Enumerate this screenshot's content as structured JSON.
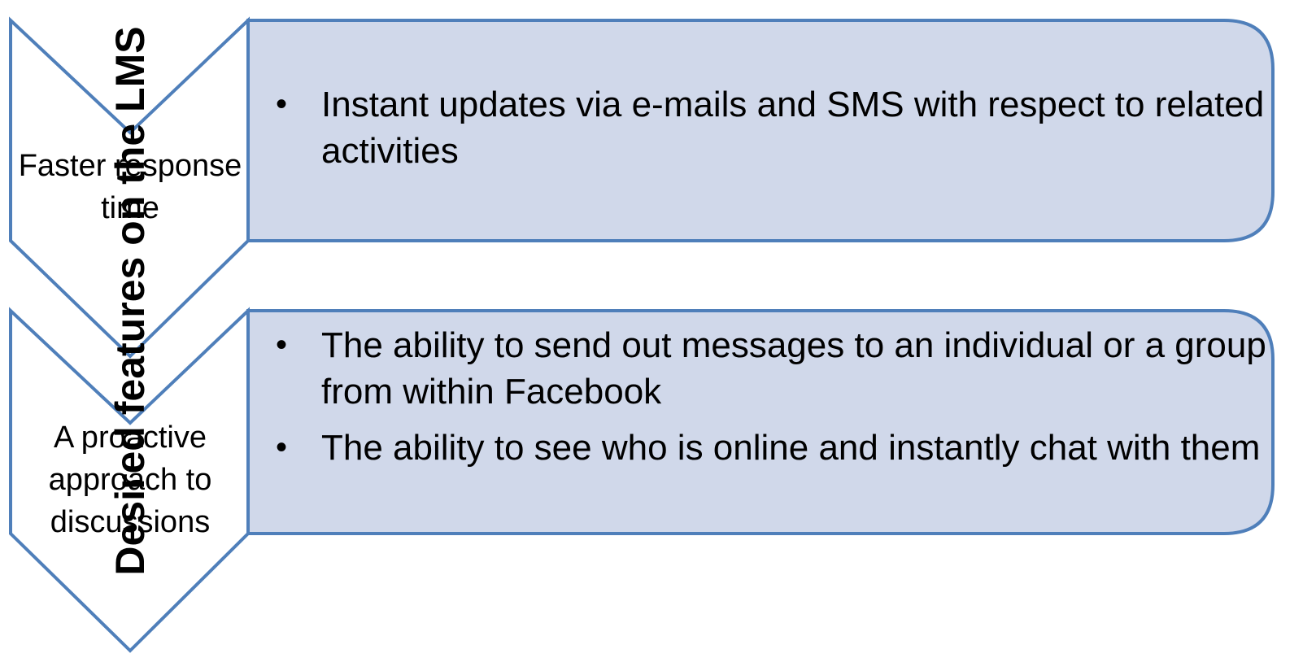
{
  "diagram": {
    "title": "Desired features on the LMS",
    "colors": {
      "outline": "#4f7fba",
      "panel_fill": "#d0d8ea",
      "chevron_fill": "#ffffff",
      "text": "#000000"
    },
    "rows": [
      {
        "label": "Faster response time",
        "bullets": [
          "Instant updates via e-mails and SMS with respect to related activities"
        ]
      },
      {
        "label": "A proactive approach to discussions",
        "bullets": [
          "The ability to send out messages to an individual or a group from within Facebook",
          "The ability to see who is online and instantly chat with them"
        ]
      }
    ]
  }
}
